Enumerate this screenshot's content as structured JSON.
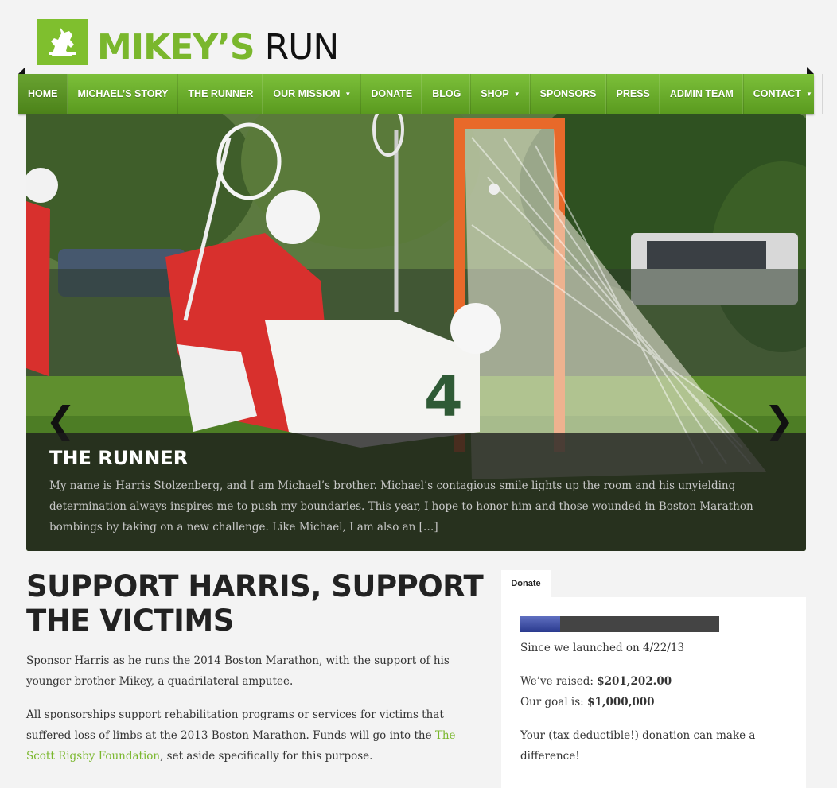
{
  "logo": {
    "brand_main": "MIKEY’S",
    "brand_sub": "RUN",
    "icon": "unicorn-icon",
    "color": "#7ab72d"
  },
  "nav": {
    "items": [
      {
        "label": "HOME",
        "active": true
      },
      {
        "label": "MICHAEL’S STORY"
      },
      {
        "label": "THE RUNNER"
      },
      {
        "label": "OUR MISSION",
        "dropdown": true
      },
      {
        "label": "DONATE"
      },
      {
        "label": "BLOG"
      },
      {
        "label": "SHOP",
        "dropdown": true
      },
      {
        "label": "SPONSORS"
      },
      {
        "label": "PRESS"
      },
      {
        "label": "ADMIN TEAM"
      },
      {
        "label": "CONTACT",
        "dropdown": true
      }
    ],
    "dropdown_glyph": "▼"
  },
  "slider": {
    "prev_icon": "chevron-left-icon",
    "next_icon": "chevron-right-icon",
    "prev_glyph": "❮",
    "next_glyph": "❯",
    "jersey_number": "4",
    "caption_title": "THE RUNNER",
    "caption_text": " My name is Harris Stolzenberg, and I am Michael’s brother.  Michael’s contagious smile lights up the room and his unyielding determination always inspires me to push my boundaries.  This year, I hope to honor him and those wounded in Boston Marathon bombings by taking on a new challenge.  Like Michael, I am also an […]"
  },
  "main": {
    "title": "SUPPORT HARRIS, SUPPORT THE VICTIMS",
    "para1": "Sponsor Harris as he runs the 2014 Boston Marathon, with the support of his younger brother Mikey, a quadrilateral amputee.",
    "para2_before": "All sponsorships support rehabilitation programs or services for victims that suffered loss of limbs at the 2013 Boston Marathon. Funds will go into the ",
    "para2_link": "The Scott Rigsby Foundation",
    "para2_after": ", set aside specifically for this purpose."
  },
  "donate_widget": {
    "tab_label": "Donate",
    "progress_fraction": 0.201,
    "launched": "Since we launched on 4/22/13",
    "raised_label": "We’ve raised: ",
    "raised_value": "$201,202.00",
    "goal_label": "Our goal is: ",
    "goal_value": "$1,000,000",
    "cta": "Your (tax deductible!) donation can make a difference!"
  }
}
